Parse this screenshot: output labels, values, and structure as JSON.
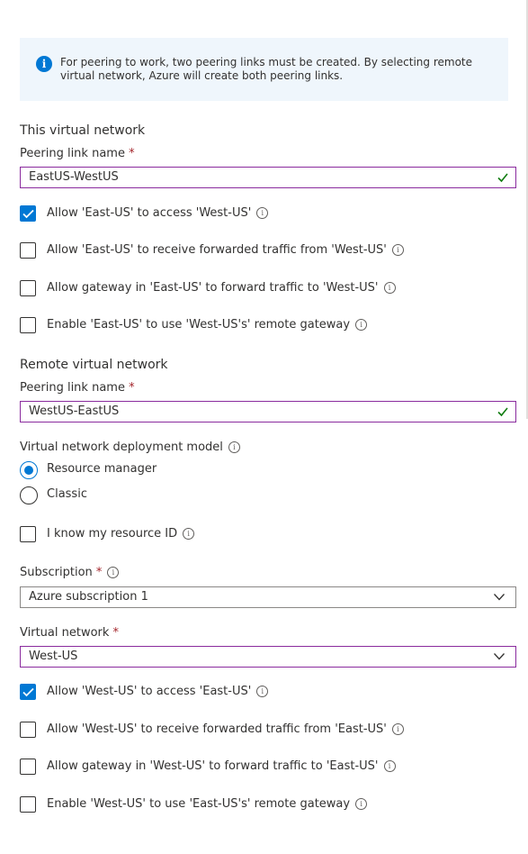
{
  "info_banner": {
    "text": "For peering to work, two peering links must be created. By selecting remote virtual network, Azure will create both peering links."
  },
  "this_network": {
    "section_title": "This virtual network",
    "peering_label": "Peering link name",
    "required_mark": "*",
    "peering_value": "EastUS-WestUS",
    "options": [
      {
        "label": "Allow 'East-US' to access 'West-US'",
        "checked": true
      },
      {
        "label": "Allow 'East-US' to receive forwarded traffic from 'West-US'",
        "checked": false
      },
      {
        "label": "Allow gateway in 'East-US' to forward traffic to 'West-US'",
        "checked": false
      },
      {
        "label": "Enable 'East-US' to use 'West-US's' remote gateway",
        "checked": false
      }
    ]
  },
  "remote_network": {
    "section_title": "Remote virtual network",
    "peering_label": "Peering link name",
    "required_mark": "*",
    "peering_value": "WestUS-EastUS",
    "deployment_label": "Virtual network deployment model",
    "deployment_options": [
      {
        "label": "Resource manager",
        "selected": true
      },
      {
        "label": "Classic",
        "selected": false
      }
    ],
    "resource_id_label": "I know my resource ID",
    "subscription_label": "Subscription",
    "subscription_value": "Azure subscription 1",
    "vnet_label": "Virtual network",
    "vnet_value": "West-US",
    "options": [
      {
        "label": "Allow 'West-US' to access 'East-US'",
        "checked": true
      },
      {
        "label": "Allow 'West-US' to receive forwarded traffic from 'East-US'",
        "checked": false
      },
      {
        "label": "Allow gateway in 'West-US' to forward traffic to 'East-US'",
        "checked": false
      },
      {
        "label": "Enable 'West-US' to use 'East-US's' remote gateway",
        "checked": false
      }
    ]
  },
  "icons": {
    "info": "info-icon",
    "check": "checkmark-icon",
    "chevron": "chevron-down-icon"
  },
  "colors": {
    "accent": "#0078d4",
    "valid": "#107c10",
    "focus_border": "#8a2b9e",
    "required": "#a4262c",
    "banner_bg": "#eff6fc"
  }
}
